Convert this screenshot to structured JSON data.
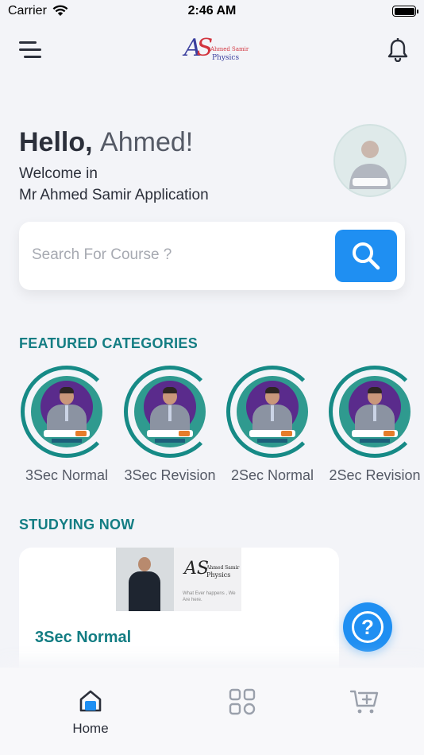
{
  "status_bar": {
    "carrier": "Carrier",
    "time": "2:46 AM"
  },
  "header": {
    "logo_line1": "Ahmed Samir",
    "logo_line2": "Physics",
    "logo_mark_a": "A",
    "logo_mark_s": "S"
  },
  "greeting": {
    "hello": "Hello,",
    "name": "Ahmed!",
    "welcome_line1": "Welcome in",
    "welcome_line2": "Mr Ahmed Samir Application"
  },
  "search": {
    "placeholder": "Search For Course ?"
  },
  "featured": {
    "title": "FEATURED CATEGORIES",
    "items": [
      {
        "label": "3Sec Normal"
      },
      {
        "label": "3Sec Revision"
      },
      {
        "label": "2Sec Normal"
      },
      {
        "label": "2Sec Revision"
      }
    ]
  },
  "studying": {
    "title": "STUDYING NOW",
    "course_title": "3Sec Normal",
    "thumb_line1": "Ahmed Samir",
    "thumb_line2": "Physics",
    "thumb_tagline": "What Ever happens , We Are here."
  },
  "tabbar": {
    "home_label": "Home",
    "active_tab": "Home"
  },
  "colors": {
    "accent_blue": "#1f8ff2",
    "teal": "#137d83",
    "background": "#f3f4f8"
  }
}
